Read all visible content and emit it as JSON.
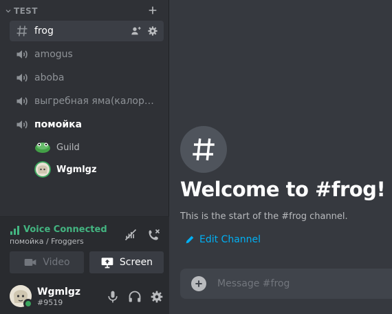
{
  "sidebar": {
    "category": {
      "label": "TEST",
      "chevron_icon": "chevron-down-icon",
      "add_icon": "plus-icon"
    },
    "channels": [
      {
        "name": "frog",
        "type": "text",
        "icon": "hashtag-icon",
        "active": true
      },
      {
        "name": "amogus",
        "type": "voice",
        "icon": "speaker-icon"
      },
      {
        "name": "aboba",
        "type": "voice",
        "icon": "speaker-icon"
      },
      {
        "name": "выгребная яма(калора...",
        "type": "voice",
        "icon": "speaker-icon"
      },
      {
        "name": "помойка",
        "type": "voice",
        "icon": "speaker-icon",
        "connected": true
      }
    ],
    "voice_users": [
      {
        "name": "Guild"
      },
      {
        "name": "Wgmlgz"
      }
    ]
  },
  "voice_panel": {
    "status": "Voice Connected",
    "location": "помойка / Froggers",
    "video_label": "Video",
    "screen_label": "Screen",
    "accent_color": "#43b581"
  },
  "user_panel": {
    "username": "Wgmlgz",
    "tag": "#9519",
    "status_color": "#3ba55d"
  },
  "main": {
    "welcome_title": "Welcome to #frog!",
    "welcome_subtitle": "This is the start of the #frog channel.",
    "edit_channel_label": "Edit Channel",
    "composer_placeholder": "Message #frog",
    "link_color": "#00b0f4"
  }
}
